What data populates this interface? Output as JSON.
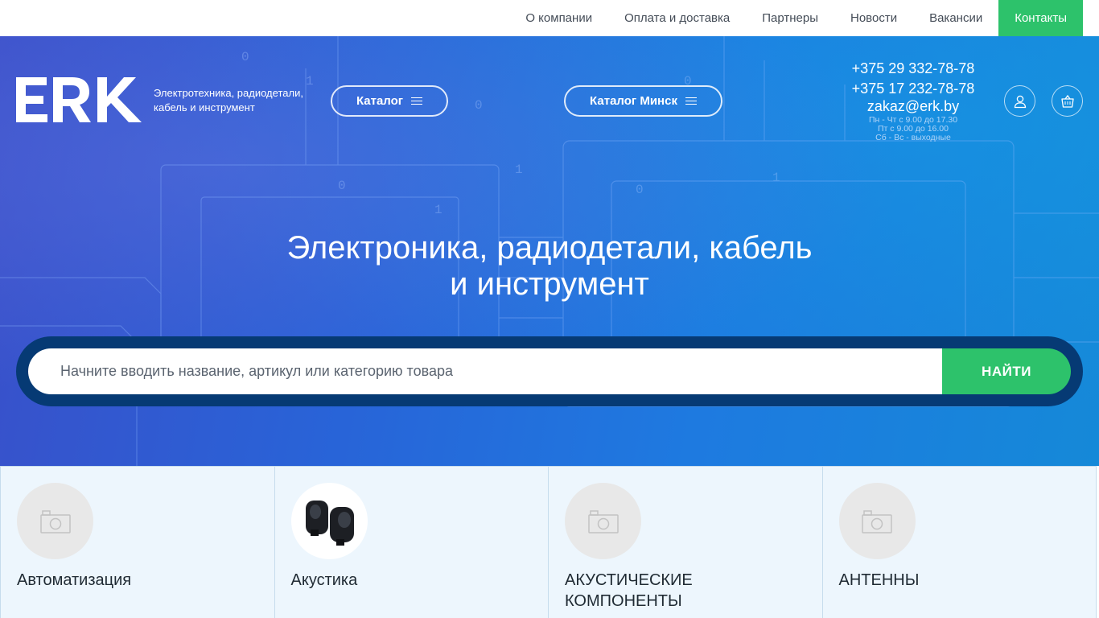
{
  "topnav": {
    "items": [
      {
        "label": "О компании"
      },
      {
        "label": "Оплата и доставка"
      },
      {
        "label": "Партнеры"
      },
      {
        "label": "Новости"
      },
      {
        "label": "Вакансии"
      },
      {
        "label": "Контакты",
        "active": true
      }
    ]
  },
  "header": {
    "logo_text": "ERK",
    "tagline": "Электротехника, радиодетали, кабель и инструмент",
    "catalog_button": "Каталог",
    "catalog_minsk_button": "Каталог Минск",
    "phone_1": "+375 29 332-78-78",
    "phone_2": "+375 17 232-78-78",
    "email": "zakaz@erk.by",
    "hours": [
      "Пн - Чт с 9.00 до 17.30",
      "Пт с 9.00 до 16.00",
      "Сб - Вс - выходные"
    ],
    "icons": [
      "user-icon",
      "cart-icon",
      "menu-icon"
    ]
  },
  "hero": {
    "title_line1": "Электроника, радиодетали, кабель",
    "title_line2": "и инструмент"
  },
  "search": {
    "placeholder": "Начните вводить название, артикул или категорию товара",
    "value": "",
    "button_label": "НАЙТИ"
  },
  "categories": [
    {
      "name": "Автоматизация",
      "image": "placeholder-camera-icon"
    },
    {
      "name": "Акустика",
      "image": "speaker-photo"
    },
    {
      "name": "АКУСТИЧЕСКИЕ КОМПОНЕНТЫ",
      "image": "placeholder-camera-icon"
    },
    {
      "name": "АНТЕННЫ",
      "image": "placeholder-camera-icon"
    }
  ],
  "colors": {
    "accent_green": "#2dc26b",
    "hero_blue": "#2864d8",
    "search_frame": "#063a74",
    "category_bg": "#edf6fd"
  }
}
